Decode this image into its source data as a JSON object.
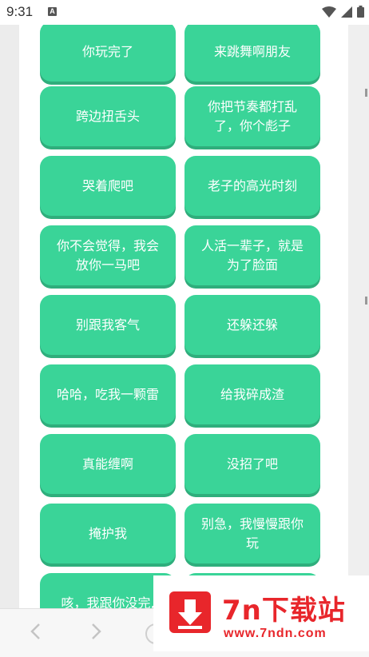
{
  "status_bar": {
    "time": "9:31",
    "notification_badge": "A",
    "icons": [
      "wifi-icon",
      "cellular-signal-icon",
      "battery-icon"
    ]
  },
  "theme": {
    "button_color": "#3ad498",
    "button_shadow": "#2fae7c",
    "button_text": "#ffffff",
    "watermark_color": "#e8262b"
  },
  "phrases": [
    "你玩完了",
    "来跳舞啊朋友",
    "跨边扭舌头",
    "你把节奏都打乱了，你个彪子",
    "哭着爬吧",
    "老子的高光时刻",
    "你不会觉得，我会放你一马吧",
    "人活一辈子，就是为了脸面",
    "别跟我客气",
    "还躲还躲",
    "哈哈，吃我一颗雷",
    "给我碎成渣",
    "真能缠啊",
    "没招了吧",
    "掩护我",
    "别急，我慢慢跟你玩",
    "咳，我跟你没完,",
    ""
  ],
  "browser_nav": {
    "icons": [
      "back-arrow-icon",
      "forward-arrow-icon",
      "home-circle-icon"
    ]
  },
  "watermark": {
    "title": "7n下载站",
    "url": "www.7ndn.com",
    "icon": "download-arrow-icon"
  }
}
